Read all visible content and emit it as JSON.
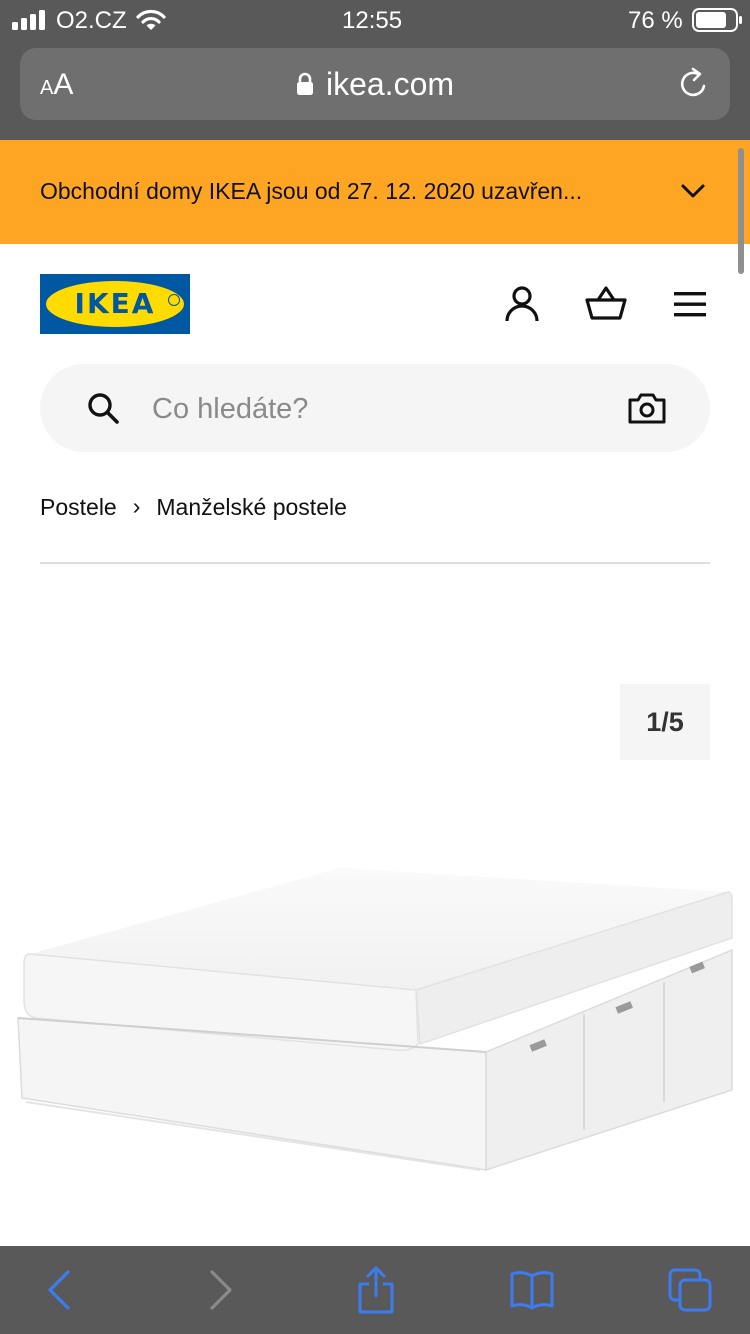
{
  "status_bar": {
    "carrier": "O2.CZ",
    "time": "12:55",
    "battery": "76 %"
  },
  "browser": {
    "text_size_label_small": "A",
    "text_size_label_large": "A",
    "domain": "ikea.com"
  },
  "banner": {
    "message": "Obchodní domy IKEA jsou od 27. 12. 2020 uzavřen..."
  },
  "header": {
    "logo_text": "IKEA"
  },
  "search": {
    "placeholder": "Co hledáte?"
  },
  "breadcrumb": {
    "items": [
      "Postele",
      "Manželské postele"
    ],
    "separator": "›"
  },
  "gallery": {
    "counter": "1/5",
    "current_image": 1,
    "total_images": 5
  },
  "colors": {
    "banner": "#ffa524",
    "ikea_blue": "#0058a3",
    "ikea_yellow": "#ffdb00",
    "browser_chrome": "#595959",
    "toolbar_icon": "#3d7cf0",
    "search_bg": "#f5f5f5"
  },
  "icons": {
    "header": [
      "account-icon",
      "shopping-basket-icon",
      "menu-icon"
    ],
    "search": [
      "search-icon",
      "camera-icon"
    ],
    "toolbar": [
      "back-icon",
      "forward-icon",
      "share-icon",
      "bookmarks-icon",
      "tabs-icon"
    ]
  }
}
